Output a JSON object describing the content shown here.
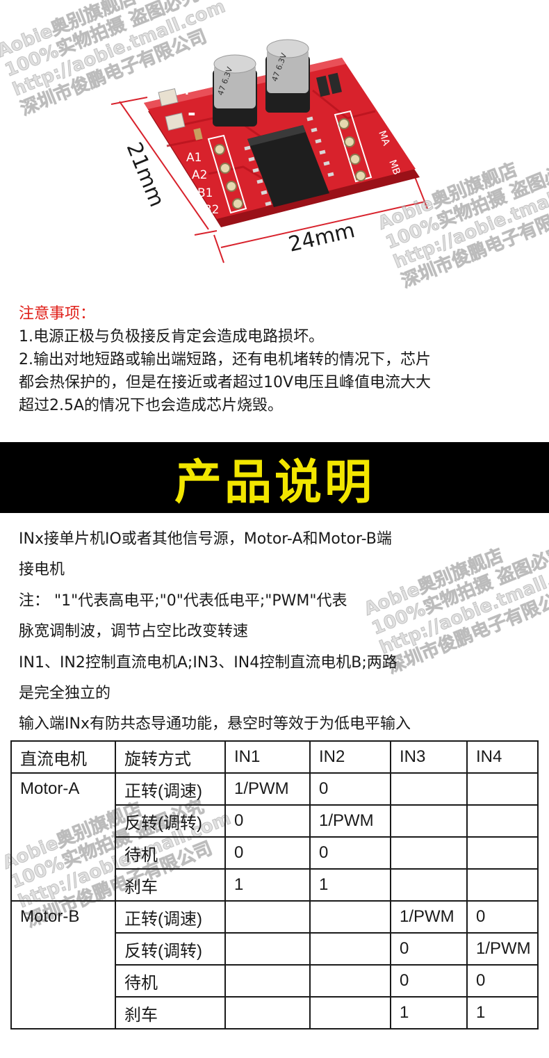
{
  "photo": {
    "capacitor_left_text": "47 6.3V",
    "capacitor_right_text": "47 6.3V",
    "pin_plus": "+",
    "pin_minus": "-",
    "pin_labels": [
      "A1",
      "A2",
      "B1",
      "B2"
    ],
    "side_label_a": "MA",
    "side_label_b": "MB",
    "dimension_height": "21mm",
    "dimension_width": "24mm"
  },
  "watermark": {
    "line1": "Aobie奥别旗舰店",
    "line2": "100%实物拍摄 盗图必究",
    "line3": "http://aobie.tmall.com",
    "line4": "深圳市俊鹏电子有限公司"
  },
  "notes": {
    "title": "注意事项：",
    "lines": [
      "1.电源正极与负极接反肯定会造成电路损坏。",
      "2.输出对地短路或输出端短路，还有电机堵转的情况下，芯片",
      "都会热保护的，但是在接近或者超过10V电压且峰值电流大大",
      "超过2.5A的情况下也会造成芯片烧毁。"
    ]
  },
  "banner": {
    "title": "产品说明"
  },
  "description": {
    "lines": [
      "INx接单片机IO或者其他信号源，Motor-A和Motor-B端",
      "接电机",
      "注： \"1\"代表高电平;\"0\"代表低电平;\"PWM\"代表",
      "脉宽调制波，调节占空比改变转速",
      "IN1、IN2控制直流电机A;IN3、IN4控制直流电机B;两路",
      "是完全独立的",
      "输入端INx有防共态导通功能，悬空时等效于为低电平输入"
    ]
  },
  "table": {
    "headers": [
      "直流电机",
      "旋转方式",
      "IN1",
      "IN2",
      "IN3",
      "IN4"
    ],
    "motor_a": {
      "name": "Motor-A",
      "rows": [
        [
          "正转(调速)",
          "1/PWM",
          "0",
          "",
          ""
        ],
        [
          "反转(调转)",
          "0",
          "1/PWM",
          "",
          ""
        ],
        [
          "待机",
          "0",
          "0",
          "",
          ""
        ],
        [
          "刹车",
          "1",
          "1",
          "",
          ""
        ]
      ]
    },
    "motor_b": {
      "name": "Motor-B",
      "rows": [
        [
          "正转(调速)",
          "",
          "",
          "1/PWM",
          "0"
        ],
        [
          "反转(调转)",
          "",
          "",
          "0",
          "1/PWM"
        ],
        [
          "待机",
          "",
          "",
          "0",
          "0"
        ],
        [
          "刹车",
          "",
          "",
          "1",
          "1"
        ]
      ]
    }
  },
  "colors": {
    "pcb_red": "#d8222c",
    "warning_red": "#e0201a",
    "banner_black": "#000000",
    "banner_yellow": "#f2e600"
  }
}
